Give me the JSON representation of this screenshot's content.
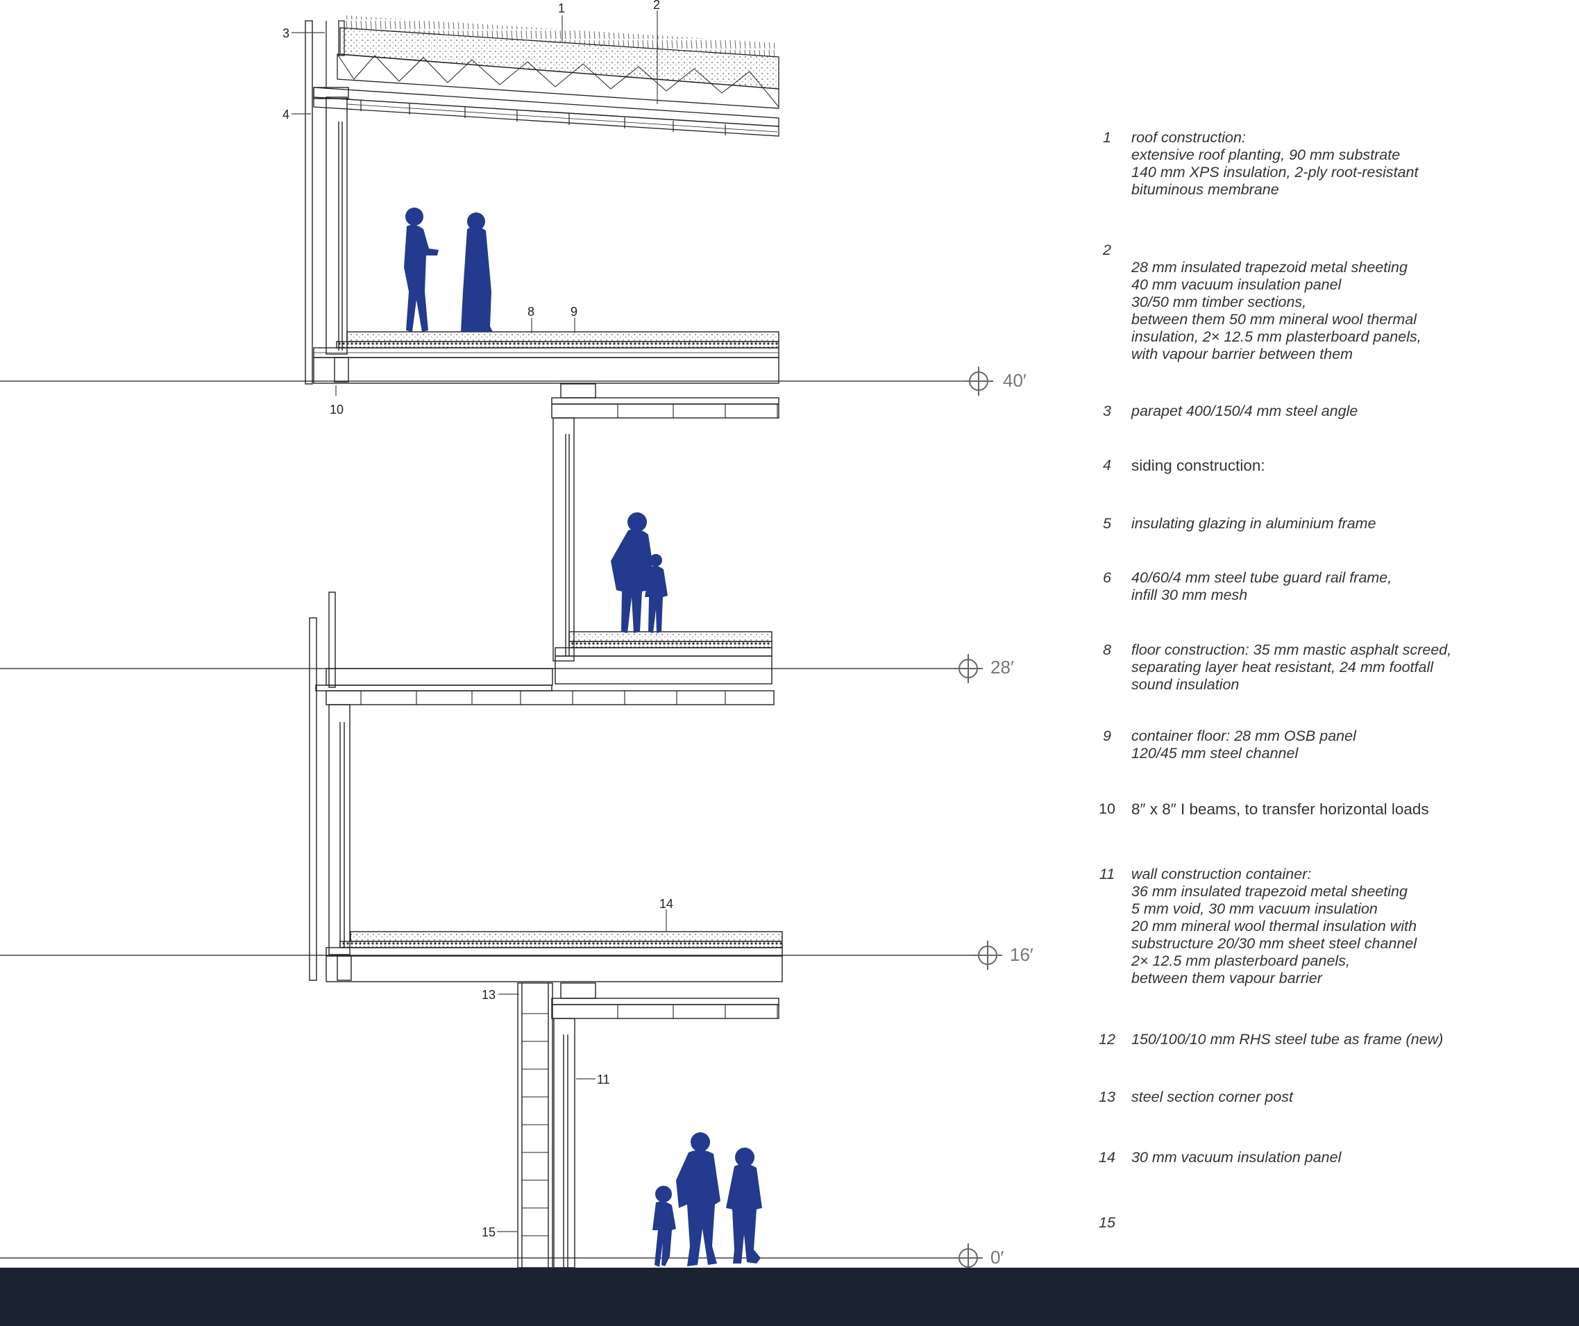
{
  "colors": {
    "silhouette": "#233a8e",
    "line": "#222222",
    "ground": "#1b2230",
    "level": "#777777"
  },
  "levels": [
    {
      "id": "l40",
      "label": "40′"
    },
    {
      "id": "l28",
      "label": "28′"
    },
    {
      "id": "l16",
      "label": "16′"
    },
    {
      "id": "l0",
      "label": "0′"
    }
  ],
  "callouts": [
    "1",
    "2",
    "3",
    "4",
    "8",
    "9",
    "10",
    "13",
    "11",
    "14",
    "15"
  ],
  "legend": [
    {
      "num": "1",
      "text": "roof construction:\nextensive roof planting, 90 mm substrate\n140 mm XPS insulation, 2-ply root-resistant\nbituminous membrane"
    },
    {
      "num": "2",
      "text": "\n28 mm insulated trapezoid metal sheeting\n40 mm vacuum insulation panel\n30/50 mm timber sections,\nbetween them 50 mm mineral wool thermal\ninsulation, 2× 12.5 mm plasterboard panels,\nwith vapour barrier between them"
    },
    {
      "num": "3",
      "text": "parapet 400/150/4 mm steel angle"
    },
    {
      "num": "4",
      "text": "siding construction:"
    },
    {
      "num": "5",
      "text": "insulating glazing in aluminium frame"
    },
    {
      "num": "6",
      "text": "40/60/4 mm steel tube guard rail frame,\ninfill 30 mm mesh"
    },
    {
      "num": "8",
      "text": "floor construction: 35 mm mastic asphalt screed,\nseparating layer heat resistant, 24 mm footfall\nsound insulation"
    },
    {
      "num": "9",
      "text": "container floor: 28 mm OSB panel\n120/45 mm steel channel"
    },
    {
      "num": "10",
      "text": "8″ x 8″ I beams, to transfer horizontal loads"
    },
    {
      "num": "11",
      "text": "wall construction container:\n36 mm insulated trapezoid metal sheeting\n5 mm void, 30 mm vacuum insulation\n20 mm mineral wool thermal insulation with\nsubstructure 20/30 mm sheet steel channel\n2× 12.5 mm plasterboard panels,\nbetween them vapour barrier"
    },
    {
      "num": "12",
      "text": "150/100/10 mm RHS steel tube as frame (new)"
    },
    {
      "num": "13",
      "text": "steel section corner post"
    },
    {
      "num": "14",
      "text": "30 mm vacuum insulation panel"
    },
    {
      "num": "15",
      "text": ""
    }
  ]
}
